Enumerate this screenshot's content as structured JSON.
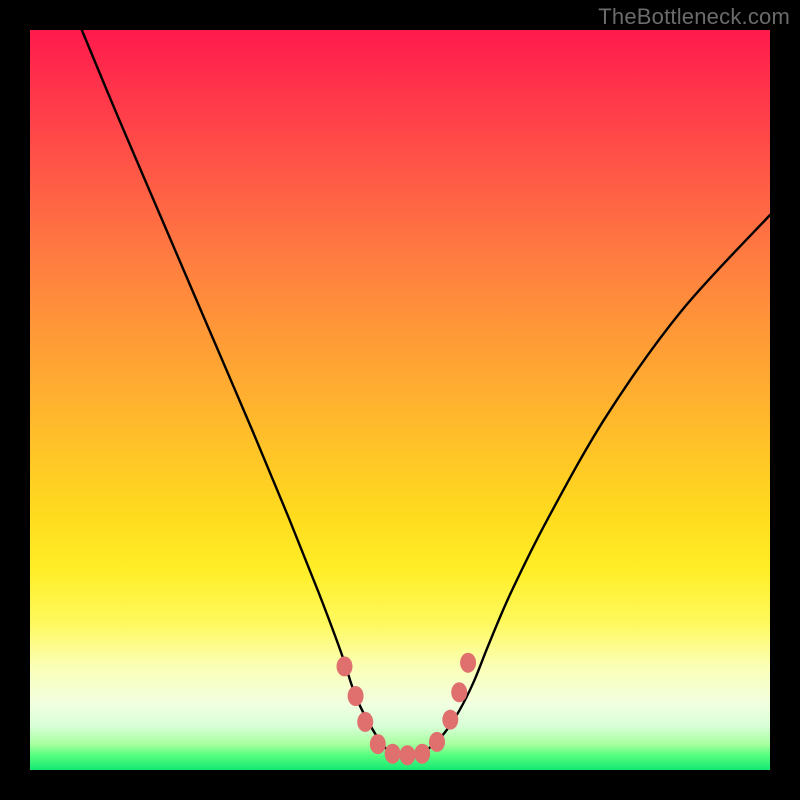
{
  "watermark": "TheBottleneck.com",
  "chart_data": {
    "type": "line",
    "title": "",
    "xlabel": "",
    "ylabel": "",
    "xlim": [
      0,
      100
    ],
    "ylim": [
      0,
      100
    ],
    "grid": false,
    "legend": null,
    "series": [
      {
        "name": "bottleneck-curve",
        "color": "#000000",
        "x": [
          7,
          12,
          18,
          24,
          30,
          35,
          39,
          42,
          44,
          46,
          48,
          50,
          52,
          54,
          56,
          58,
          60,
          62,
          65,
          70,
          78,
          88,
          100
        ],
        "y": [
          100,
          88,
          74,
          60,
          46,
          34,
          24,
          16,
          10,
          6,
          3,
          2,
          2,
          3,
          5,
          8,
          12,
          17,
          24,
          34,
          48,
          62,
          75
        ]
      }
    ],
    "markers": {
      "name": "highlight-dots",
      "color": "#e0706e",
      "r": 8,
      "points": [
        {
          "x": 42.5,
          "y": 14
        },
        {
          "x": 44.0,
          "y": 10
        },
        {
          "x": 45.3,
          "y": 6.5
        },
        {
          "x": 47.0,
          "y": 3.5
        },
        {
          "x": 49.0,
          "y": 2.2
        },
        {
          "x": 51.0,
          "y": 2.0
        },
        {
          "x": 53.0,
          "y": 2.2
        },
        {
          "x": 55.0,
          "y": 3.8
        },
        {
          "x": 56.8,
          "y": 6.8
        },
        {
          "x": 58.0,
          "y": 10.5
        },
        {
          "x": 59.2,
          "y": 14.5
        }
      ]
    },
    "background_gradient": {
      "top": "#ff1a4d",
      "mid": "#ffdc1e",
      "bottom": "#14e873"
    }
  }
}
